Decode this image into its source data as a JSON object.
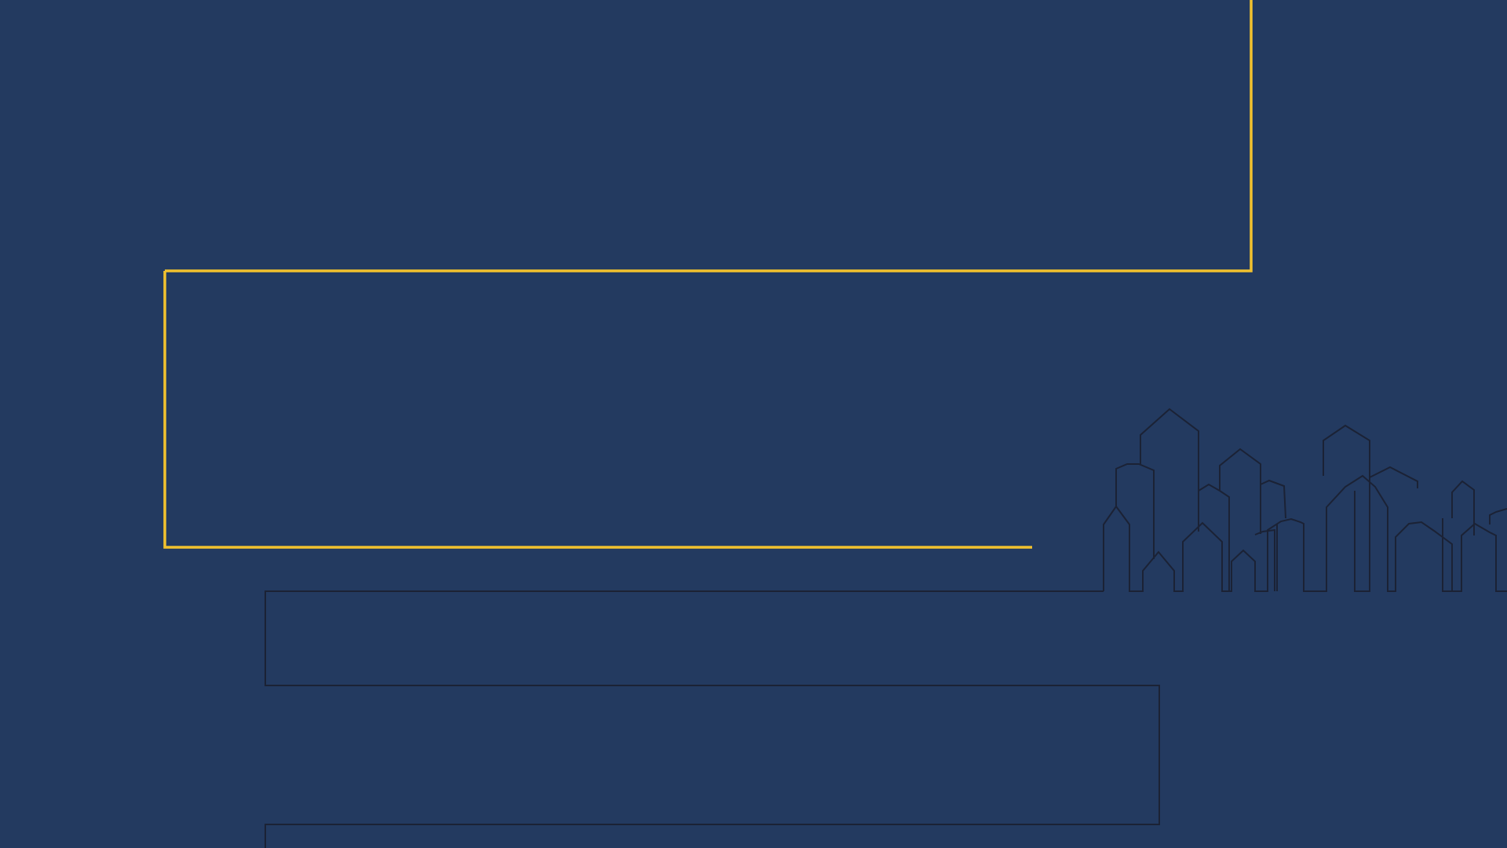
{
  "slide": {
    "background_color": "#233a60",
    "accent_color": "#f2c12e",
    "outline_color": "#1b2235",
    "decoration": "city-skyline-outline"
  }
}
